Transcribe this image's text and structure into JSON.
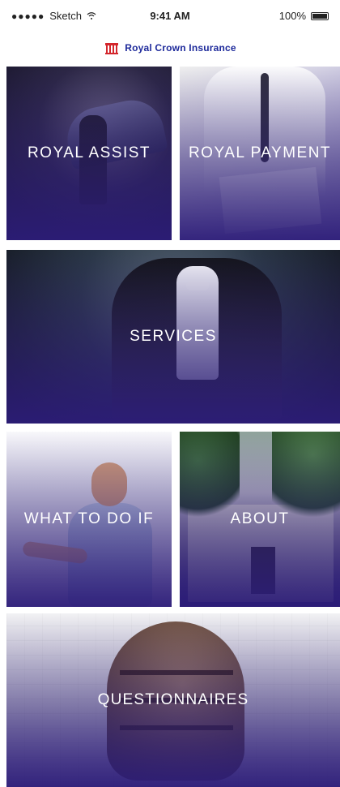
{
  "status_bar": {
    "carrier": "Sketch",
    "time": "9:41 AM",
    "battery": "100%"
  },
  "header": {
    "brand_name": "Royal Crown Insurance",
    "accent_color": "#1e2a9b"
  },
  "tiles": [
    {
      "id": "royal-assist",
      "label": "ROYAL ASSIST"
    },
    {
      "id": "royal-payment",
      "label": "ROYAL PAYMENT"
    },
    {
      "id": "services",
      "label": "SERVICES"
    },
    {
      "id": "what-to-do-if",
      "label": "WHAT TO DO IF"
    },
    {
      "id": "about",
      "label": "ABOUT"
    },
    {
      "id": "questionnaires",
      "label": "QUESTIONNAIRES"
    }
  ]
}
